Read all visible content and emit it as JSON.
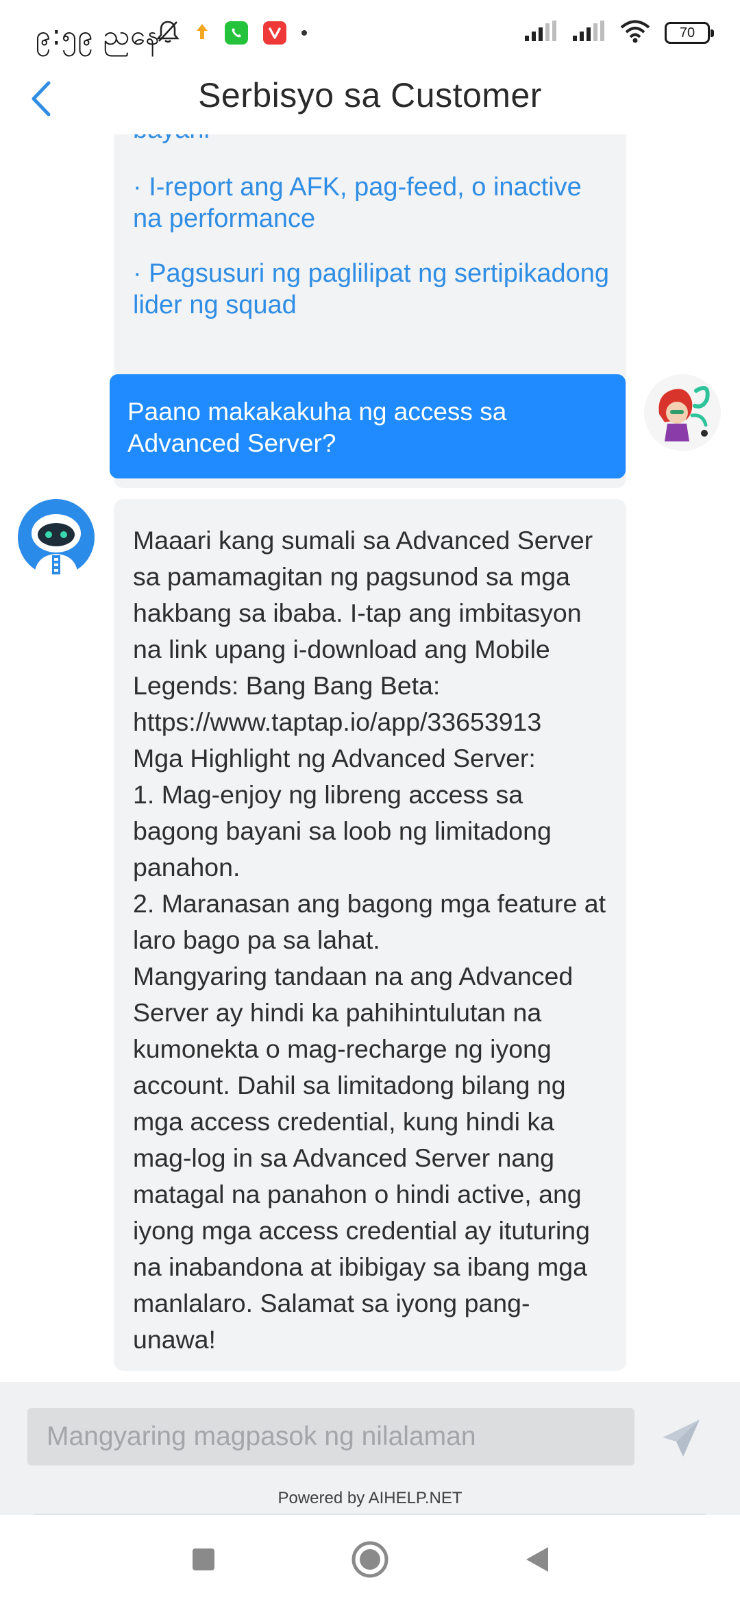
{
  "status_bar": {
    "time": "၉:၅၉ ညနေ",
    "battery": "70",
    "icons": [
      "bell-off-icon",
      "upload-arrow-icon",
      "whatsapp-icon",
      "vivaldi-icon",
      "notification-dot-icon",
      "signal-icon",
      "signal-icon",
      "wifi-icon",
      "battery-icon"
    ]
  },
  "header": {
    "title": "Serbisyo sa Customer",
    "back_icon": "chevron-left-icon"
  },
  "chat": {
    "faq_tail": "bayani",
    "faq_links": [
      "· I-report ang AFK, pag-feed, o inactive na performance",
      "· Pagsusuri ng paglilipat ng sertipikadong lider ng squad"
    ],
    "user_message": "Paano makakakuha ng access sa Advanced Server?",
    "bot_answer": "Maaari kang sumali sa Advanced Server sa pamamagitan ng pagsunod sa mga hakbang sa ibaba. I-tap ang imbitasyon na link upang i-download ang Mobile Legends: Bang Bang Beta: https://www.taptap.io/app/33653913\nMga Highlight ng Advanced Server:\n1. Mag-enjoy ng libreng access sa bagong bayani sa loob ng limitadong panahon.\n2. Maranasan ang bagong mga feature at laro bago pa sa lahat.\nMangyaring tandaan na ang Advanced Server ay hindi ka pahihintulutan na kumonekta o mag-recharge ng iyong account. Dahil sa limitadong bilang ng mga access credential, kung hindi ka mag-log in sa Advanced Server nang matagal na panahon o hindi active, ang iyong mga access credential ay ituturing na inabandona at ibibigay sa ibang mga manlalaro. Salamat sa iyong pang-unawa!"
  },
  "input": {
    "placeholder": "Mangyaring magpasok ng nilalaman",
    "value": ""
  },
  "footer": {
    "powered_by": "Powered by AIHELP.NET"
  },
  "colors": {
    "accent": "#1f8bff",
    "link": "#2f8de4",
    "bubble_bg": "#f2f3f5",
    "input_bar_bg": "#f0f1f3"
  }
}
